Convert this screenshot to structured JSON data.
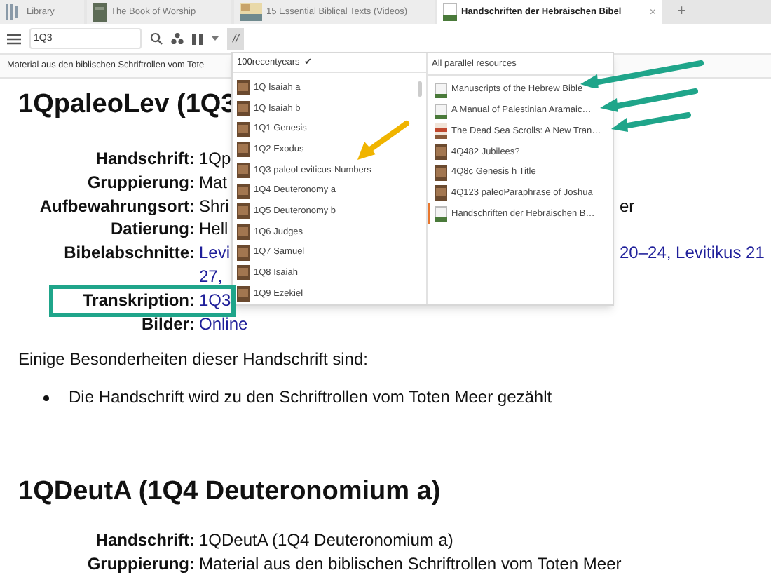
{
  "tabs": [
    {
      "label": "Library",
      "kind": "library",
      "selected": false
    },
    {
      "label": "The Book of Worship",
      "kind": "book",
      "selected": false
    },
    {
      "label": "15 Essential Biblical Texts (Videos)",
      "kind": "video",
      "selected": false
    },
    {
      "label": "Handschriften der Hebräischen Bibel",
      "kind": "page",
      "selected": true,
      "close": "×"
    }
  ],
  "new_tab": "+",
  "toolbar": {
    "search_value": "1Q3",
    "parallel_button": "//",
    "parallel_active": true
  },
  "breadcrumb": "Material aus den biblischen Schriftrollen vom Tote",
  "article": {
    "title": "1QpaleoLev (1Q3",
    "rows": [
      {
        "label": "Handschrift:",
        "value": "1Qp"
      },
      {
        "label": "Gruppierung:",
        "value": "Mat"
      },
      {
        "label": "Aufbewahrungsort:",
        "value": "Shri",
        "right": "er"
      },
      {
        "label": "Datierung:",
        "value": "Hell"
      },
      {
        "label": "Bibelabschnitte:",
        "value": "Levi",
        "link": true,
        "right": "20–24, Levitikus 21"
      },
      {
        "label": "",
        "value": "27,",
        "link": true
      },
      {
        "label": "Transkription:",
        "value": "1Q3",
        "link": true
      },
      {
        "label": "Bilder:",
        "value": "Online",
        "link": true
      }
    ],
    "intro": "Einige Besonderheiten dieser Handschrift sind:",
    "bullets": [
      "Die Handschrift wird zu den Schriftrollen vom Toten Meer gezählt"
    ],
    "title_2": "1QDeutA (1Q4 Deuteronomium a)",
    "rows_2": [
      {
        "label": "Handschrift:",
        "value": "1QDeutA (1Q4 Deuteronomium a)"
      },
      {
        "label": "Gruppierung:",
        "value": "Material aus den biblischen Schriftrollen vom Toten Meer"
      }
    ]
  },
  "dropdown": {
    "collection": "100recentyears",
    "collection_mark": "✔",
    "items": [
      "1Q Isaiah a",
      "1Q Isaiah b",
      "1Q1 Genesis",
      "1Q2 Exodus",
      "1Q3 paleoLeviticus-Numbers",
      "1Q4 Deuteronomy a",
      "1Q5 Deuteronomy b",
      "1Q6 Judges",
      "1Q7 Samuel",
      "1Q8 Isaiah",
      "1Q9 Ezekiel"
    ],
    "parallel_header": "All parallel resources",
    "parallel": [
      {
        "label": "Manuscripts of the Hebrew Bible",
        "kind": "book",
        "selected": false
      },
      {
        "label": "A Manual of Palestinian Aramaic…",
        "kind": "book",
        "selected": false
      },
      {
        "label": "The Dead Sea Scrolls: A New Tran…",
        "kind": "red-book",
        "selected": false
      },
      {
        "label": "4Q482 Jubilees?",
        "kind": "scroll",
        "selected": false
      },
      {
        "label": "4Q8c Genesis h Title",
        "kind": "scroll",
        "selected": false
      },
      {
        "label": "4Q123 paleoParaphrase of Joshua",
        "kind": "scroll",
        "selected": false
      },
      {
        "label": "Handschriften der Hebräischen B…",
        "kind": "book",
        "selected": true
      }
    ]
  }
}
